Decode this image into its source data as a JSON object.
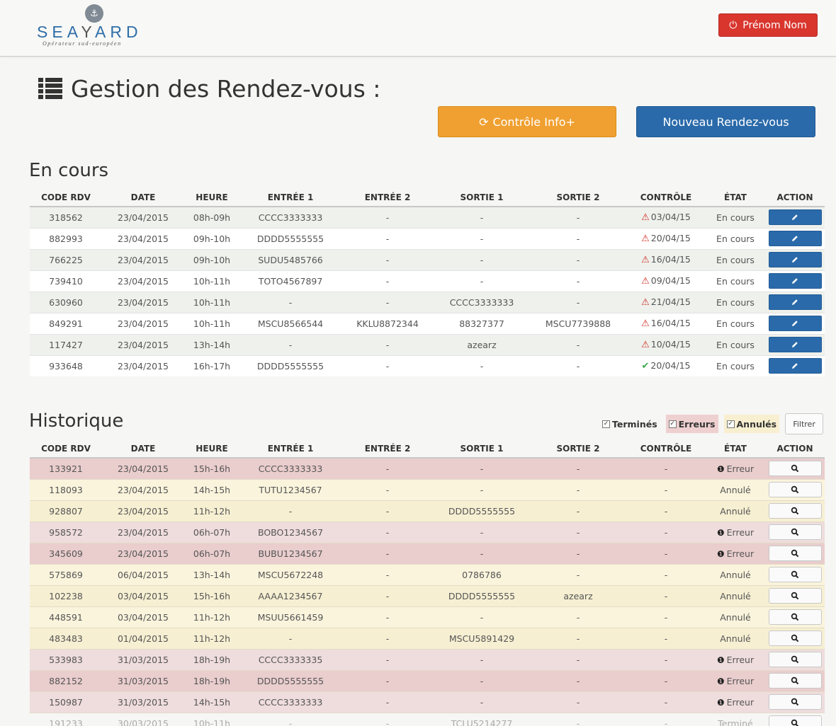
{
  "brand": {
    "name": "SEAYARD",
    "tagline": "Opérateur sud-européen",
    "color": "#2f6ea8"
  },
  "header": {
    "user_label": "Prénom Nom"
  },
  "page": {
    "title": "Gestion des Rendez-vous :",
    "control_button": "Contrôle Info+",
    "new_button": "Nouveau Rendez-vous"
  },
  "columns": [
    "CODE RDV",
    "DATE",
    "HEURE",
    "ENTRÉE 1",
    "ENTRÉE 2",
    "SORTIE 1",
    "SORTIE 2",
    "CONTRÔLE",
    "ÉTAT",
    "ACTION"
  ],
  "en_cours": {
    "title": "En cours",
    "rows": [
      {
        "code": "318562",
        "date": "23/04/2015",
        "heure": "08h-09h",
        "e1": "CCCC3333333",
        "e2": "-",
        "s1": "-",
        "s2": "-",
        "ctrl": "03/04/15",
        "ctrl_icon": "warning",
        "etat": "En cours"
      },
      {
        "code": "882993",
        "date": "23/04/2015",
        "heure": "09h-10h",
        "e1": "DDDD5555555",
        "e2": "-",
        "s1": "-",
        "s2": "-",
        "ctrl": "20/04/15",
        "ctrl_icon": "warning",
        "etat": "En cours"
      },
      {
        "code": "766225",
        "date": "23/04/2015",
        "heure": "09h-10h",
        "e1": "SUDU5485766",
        "e2": "-",
        "s1": "-",
        "s2": "-",
        "ctrl": "16/04/15",
        "ctrl_icon": "warning",
        "etat": "En cours"
      },
      {
        "code": "739410",
        "date": "23/04/2015",
        "heure": "10h-11h",
        "e1": "TOTO4567897",
        "e2": "-",
        "s1": "-",
        "s2": "-",
        "ctrl": "09/04/15",
        "ctrl_icon": "warning",
        "etat": "En cours"
      },
      {
        "code": "630960",
        "date": "23/04/2015",
        "heure": "10h-11h",
        "e1": "-",
        "e2": "-",
        "s1": "CCCC3333333",
        "s2": "-",
        "ctrl": "21/04/15",
        "ctrl_icon": "warning",
        "etat": "En cours"
      },
      {
        "code": "849291",
        "date": "23/04/2015",
        "heure": "10h-11h",
        "e1": "MSCU8566544",
        "e2": "KKLU8872344",
        "s1": "88327377",
        "s2": "MSCU7739888",
        "ctrl": "16/04/15",
        "ctrl_icon": "warning",
        "etat": "En cours"
      },
      {
        "code": "117427",
        "date": "23/04/2015",
        "heure": "13h-14h",
        "e1": "-",
        "e2": "-",
        "s1": "azearz",
        "s2": "-",
        "ctrl": "10/04/15",
        "ctrl_icon": "warning",
        "etat": "En cours"
      },
      {
        "code": "933648",
        "date": "23/04/2015",
        "heure": "16h-17h",
        "e1": "DDDD5555555",
        "e2": "-",
        "s1": "-",
        "s2": "-",
        "ctrl": "20/04/15",
        "ctrl_icon": "check",
        "etat": "En cours"
      }
    ]
  },
  "historique": {
    "title": "Historique",
    "filters": {
      "termines": "Terminés",
      "erreurs": "Erreurs",
      "annules": "Annulés",
      "button": "Filtrer"
    },
    "rows": [
      {
        "code": "133921",
        "date": "23/04/2015",
        "heure": "15h-16h",
        "e1": "CCCC3333333",
        "e2": "-",
        "s1": "-",
        "s2": "-",
        "ctrl": "-",
        "etat": "Erreur",
        "kind": "err2"
      },
      {
        "code": "118093",
        "date": "23/04/2015",
        "heure": "14h-15h",
        "e1": "TUTU1234567",
        "e2": "-",
        "s1": "-",
        "s2": "-",
        "ctrl": "-",
        "etat": "Annulé",
        "kind": "ann"
      },
      {
        "code": "928807",
        "date": "23/04/2015",
        "heure": "11h-12h",
        "e1": "-",
        "e2": "-",
        "s1": "DDDD5555555",
        "s2": "-",
        "ctrl": "-",
        "etat": "Annulé",
        "kind": "ann2"
      },
      {
        "code": "958572",
        "date": "23/04/2015",
        "heure": "06h-07h",
        "e1": "BOBO1234567",
        "e2": "-",
        "s1": "-",
        "s2": "-",
        "ctrl": "-",
        "etat": "Erreur",
        "kind": "err"
      },
      {
        "code": "345609",
        "date": "23/04/2015",
        "heure": "06h-07h",
        "e1": "BUBU1234567",
        "e2": "-",
        "s1": "-",
        "s2": "-",
        "ctrl": "-",
        "etat": "Erreur",
        "kind": "err2"
      },
      {
        "code": "575869",
        "date": "06/04/2015",
        "heure": "13h-14h",
        "e1": "MSCU5672248",
        "e2": "-",
        "s1": "0786786",
        "s2": "-",
        "ctrl": "-",
        "etat": "Annulé",
        "kind": "ann"
      },
      {
        "code": "102238",
        "date": "03/04/2015",
        "heure": "15h-16h",
        "e1": "AAAA1234567",
        "e2": "-",
        "s1": "DDDD5555555",
        "s2": "azearz",
        "ctrl": "-",
        "etat": "Annulé",
        "kind": "ann2"
      },
      {
        "code": "448591",
        "date": "03/04/2015",
        "heure": "11h-12h",
        "e1": "MSUU5661459",
        "e2": "-",
        "s1": "-",
        "s2": "-",
        "ctrl": "-",
        "etat": "Annulé",
        "kind": "ann"
      },
      {
        "code": "483483",
        "date": "01/04/2015",
        "heure": "11h-12h",
        "e1": "-",
        "e2": "-",
        "s1": "MSCU5891429",
        "s2": "-",
        "ctrl": "-",
        "etat": "Annulé",
        "kind": "ann2"
      },
      {
        "code": "533983",
        "date": "31/03/2015",
        "heure": "18h-19h",
        "e1": "CCCC3333335",
        "e2": "-",
        "s1": "-",
        "s2": "-",
        "ctrl": "-",
        "etat": "Erreur",
        "kind": "err"
      },
      {
        "code": "882152",
        "date": "31/03/2015",
        "heure": "18h-19h",
        "e1": "DDDD5555555",
        "e2": "-",
        "s1": "-",
        "s2": "-",
        "ctrl": "-",
        "etat": "Erreur",
        "kind": "err2"
      },
      {
        "code": "150987",
        "date": "31/03/2015",
        "heure": "14h-15h",
        "e1": "CCCC3333333",
        "e2": "-",
        "s1": "-",
        "s2": "-",
        "ctrl": "-",
        "etat": "Erreur",
        "kind": "err"
      },
      {
        "code": "191233",
        "date": "30/03/2015",
        "heure": "10h-11h",
        "e1": "-",
        "e2": "-",
        "s1": "TCLU5214277",
        "s2": "-",
        "ctrl": "-",
        "etat": "Terminé",
        "kind": "term"
      }
    ]
  }
}
